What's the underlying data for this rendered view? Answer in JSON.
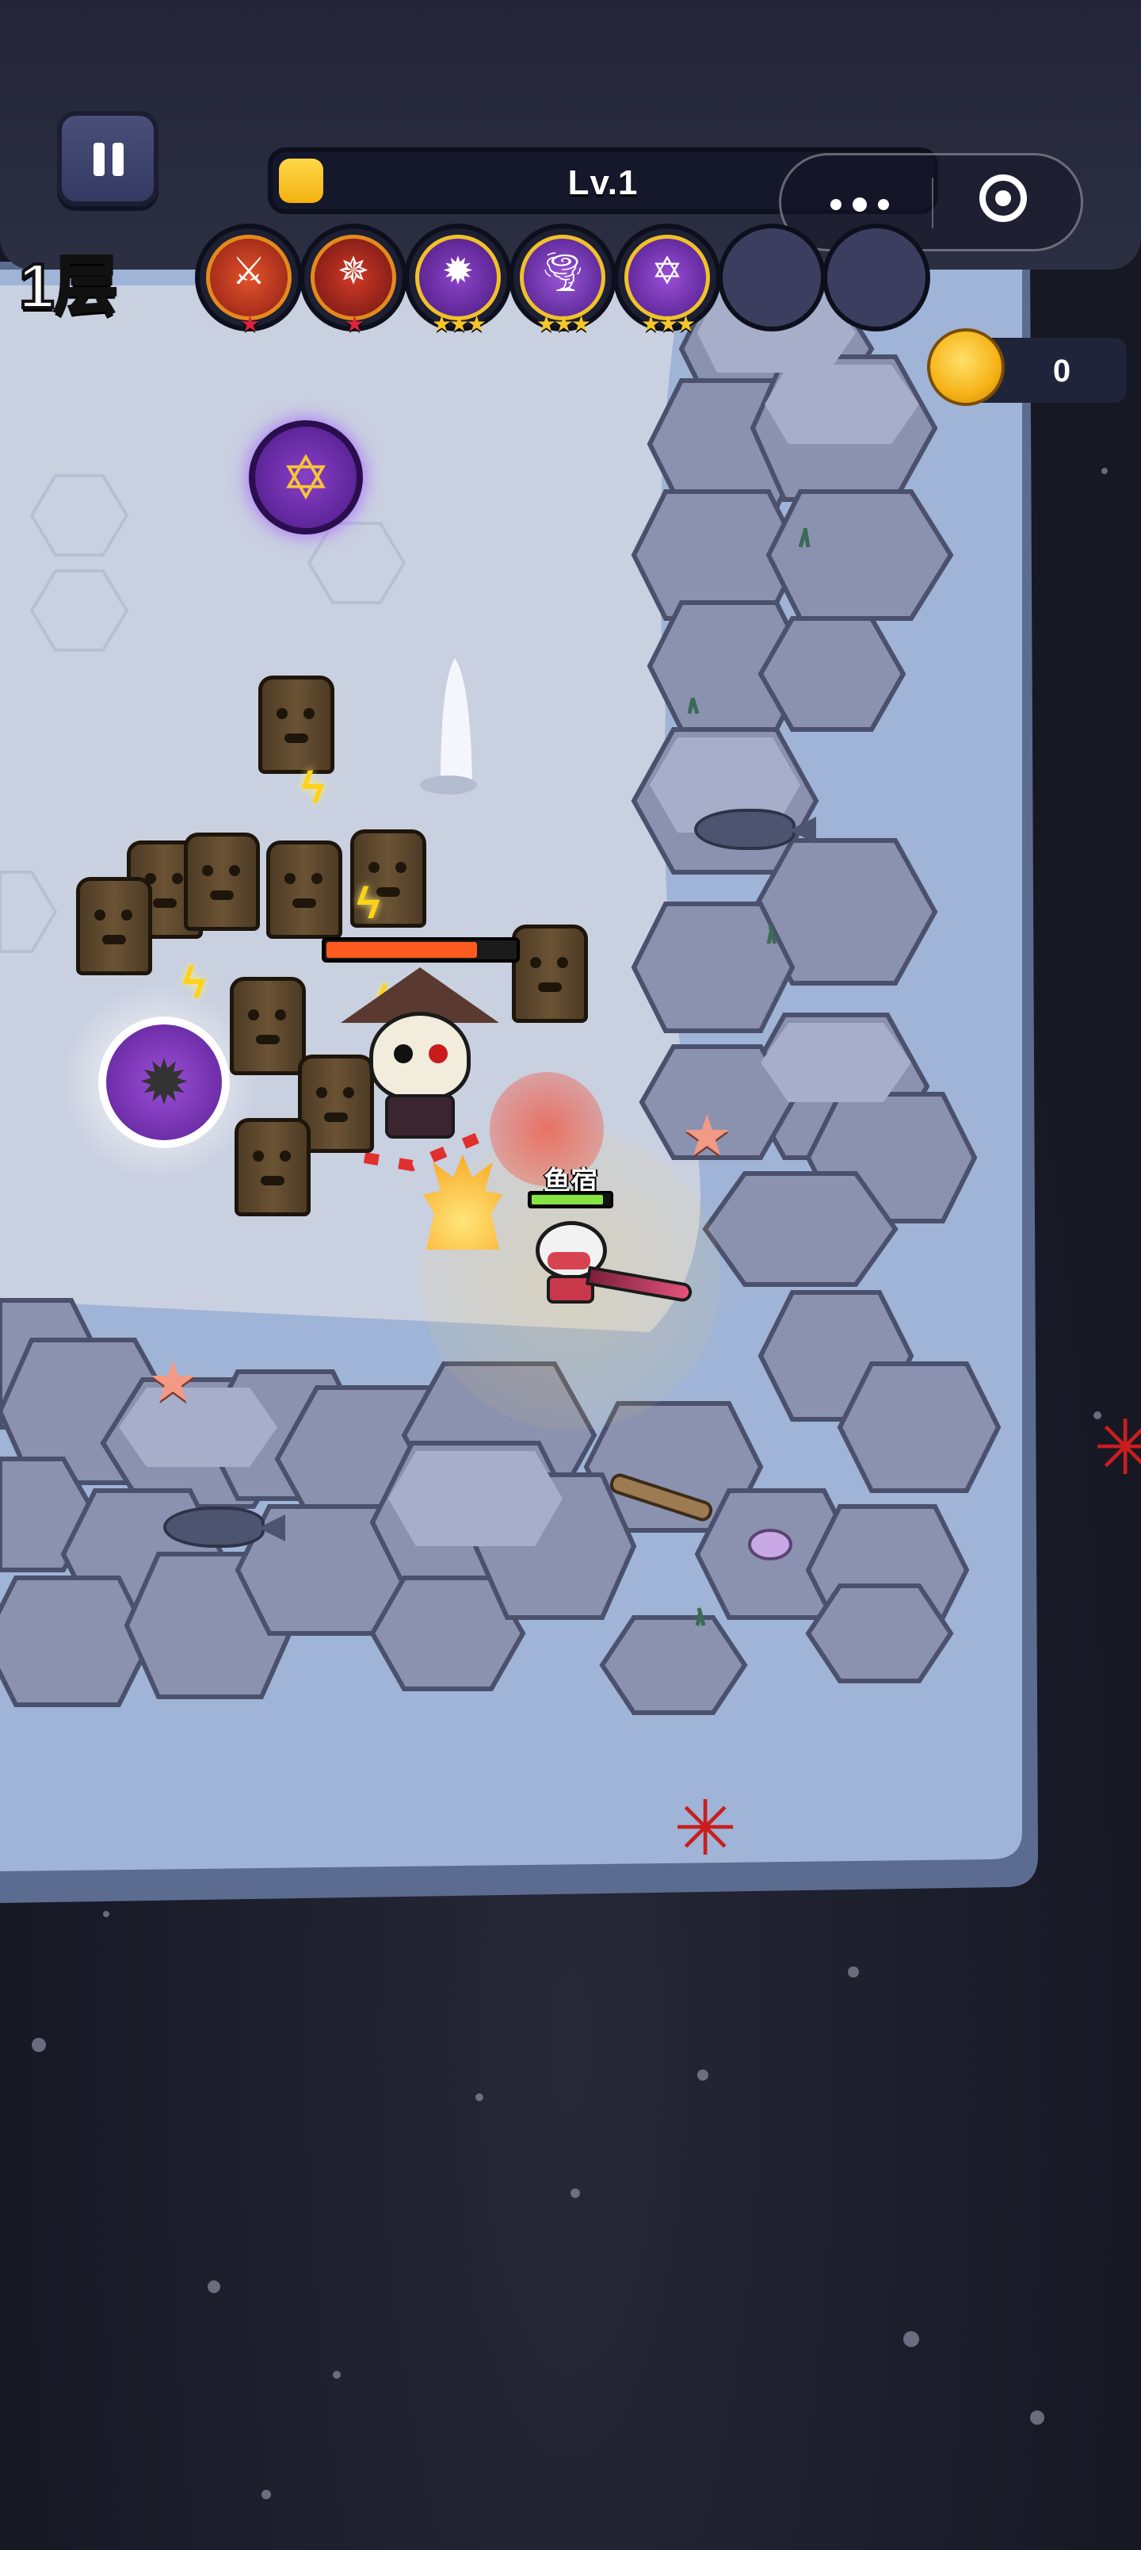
{
  "hud": {
    "floor_label": "1层",
    "level_text": "Lv.1",
    "level_progress": 0.06,
    "coin_value": "0"
  },
  "skills": [
    {
      "name": "sword-flame-skill-icon",
      "stars": 1,
      "star_color": "red",
      "glyph": "⚔"
    },
    {
      "name": "shuriken-skill-icon",
      "stars": 1,
      "star_color": "red",
      "glyph": "✵"
    },
    {
      "name": "spiked-mace-skill-icon",
      "stars": 3,
      "star_color": "gold",
      "glyph": "✹"
    },
    {
      "name": "tornado-skill-icon",
      "stars": 3,
      "star_color": "gold",
      "glyph": "🌪"
    },
    {
      "name": "hexagram-skill-icon",
      "stars": 3,
      "star_color": "gold",
      "glyph": "✡"
    },
    {
      "name": "empty-skill-slot",
      "stars": 0
    },
    {
      "name": "empty-skill-slot",
      "stars": 0
    }
  ],
  "player": {
    "name": "鱼宿",
    "hp": 0.92
  },
  "boss": {
    "hp": 0.8
  },
  "colors": {
    "gold": "#f4c62a",
    "hp_green": "#87e543",
    "boss_hp": "#ff5a1f",
    "stone": "#8d95b3",
    "floor": "#c7cede"
  }
}
